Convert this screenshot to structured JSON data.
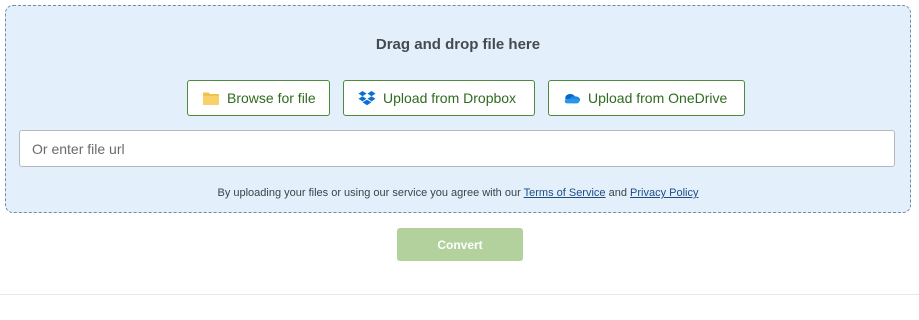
{
  "dropzone": {
    "title": "Drag and drop file here",
    "buttons": [
      {
        "label": "Browse for file",
        "icon": "folder-icon"
      },
      {
        "label": "Upload from Dropbox",
        "icon": "dropbox-icon"
      },
      {
        "label": "Upload from OneDrive",
        "icon": "onedrive-icon"
      }
    ],
    "url_input": {
      "placeholder": "Or enter file url",
      "value": ""
    },
    "terms": {
      "prefix": "By uploading your files or using our service you agree with our",
      "tos_label": "Terms of Service",
      "and": "and",
      "privacy_label": "Privacy Policy"
    }
  },
  "convert": {
    "label": "Convert",
    "state": "disabled"
  },
  "colors": {
    "dropzone_bg": "#e3f0fb",
    "button_border": "#4f8a3c",
    "button_text": "#2f6b1f",
    "convert_bg": "#b3d19d",
    "link": "#1d4d86"
  }
}
